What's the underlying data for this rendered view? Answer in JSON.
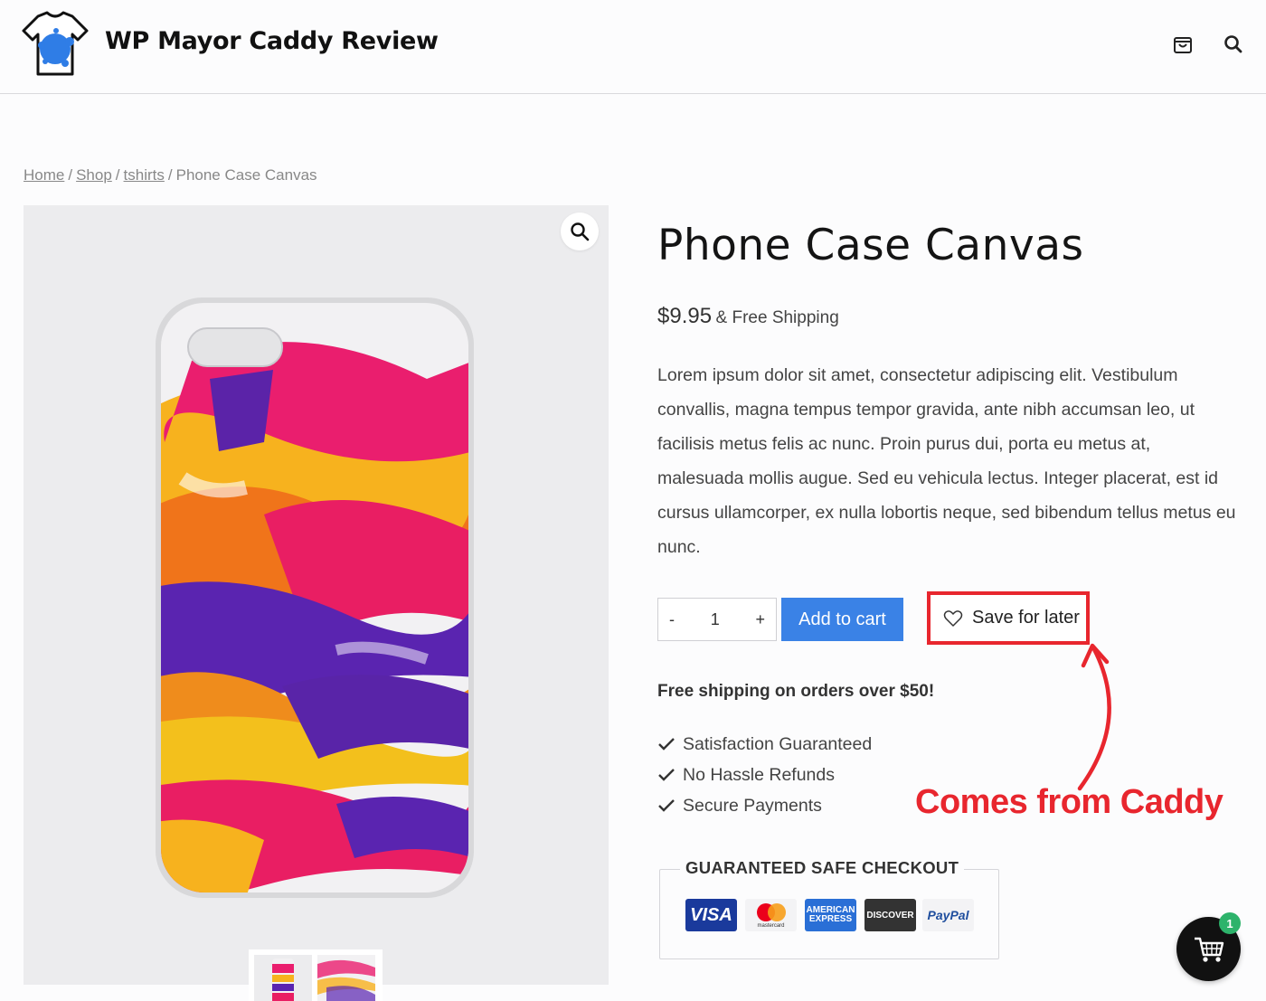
{
  "header": {
    "site_title": "WP Mayor Caddy Review",
    "icons": [
      "shopping-bag-icon",
      "search-icon"
    ]
  },
  "breadcrumb": {
    "items": [
      "Home",
      "Shop",
      "tshirts"
    ],
    "current": "Phone Case Canvas",
    "separator": "/"
  },
  "product": {
    "title": "Phone Case Canvas",
    "price": "$9.95",
    "shipping_suffix": "& Free Shipping",
    "description": "Lorem ipsum dolor sit amet, consectetur adipiscing elit. Vestibulum convallis, magna tempus tempor gravida, ante nibh accumsan leo, ut facilisis metus felis ac nunc. Proin purus dui, porta eu metus at, malesuada mollis augue. Sed eu vehicula lectus. Integer placerat, est id cursus ullamcorper, ex nulla lobortis neque, sed bibendum tellus metus eu nunc."
  },
  "purchase": {
    "quantity": "1",
    "decrement": "-",
    "increment": "+",
    "add_to_cart": "Add to cart",
    "save_for_later": "Save for later"
  },
  "info": {
    "free_shipping": "Free shipping on orders over $50!",
    "features": [
      "Satisfaction Guaranteed",
      "No Hassle Refunds",
      "Secure Payments"
    ]
  },
  "annotation": {
    "text": "Comes from Caddy",
    "color": "#e8262e"
  },
  "checkout": {
    "title": "GUARANTEED SAFE CHECKOUT",
    "payments": [
      {
        "label": "VISA"
      },
      {
        "label": "mastercard"
      },
      {
        "label": "AMERICAN EXPRESS"
      },
      {
        "label": "DISCOVER"
      },
      {
        "label": "PayPal"
      }
    ]
  },
  "cart_widget": {
    "count": "1",
    "badge_color": "#2db36b"
  },
  "colors": {
    "accent_blue": "#3a82e6",
    "annotation_red": "#e8262e"
  }
}
